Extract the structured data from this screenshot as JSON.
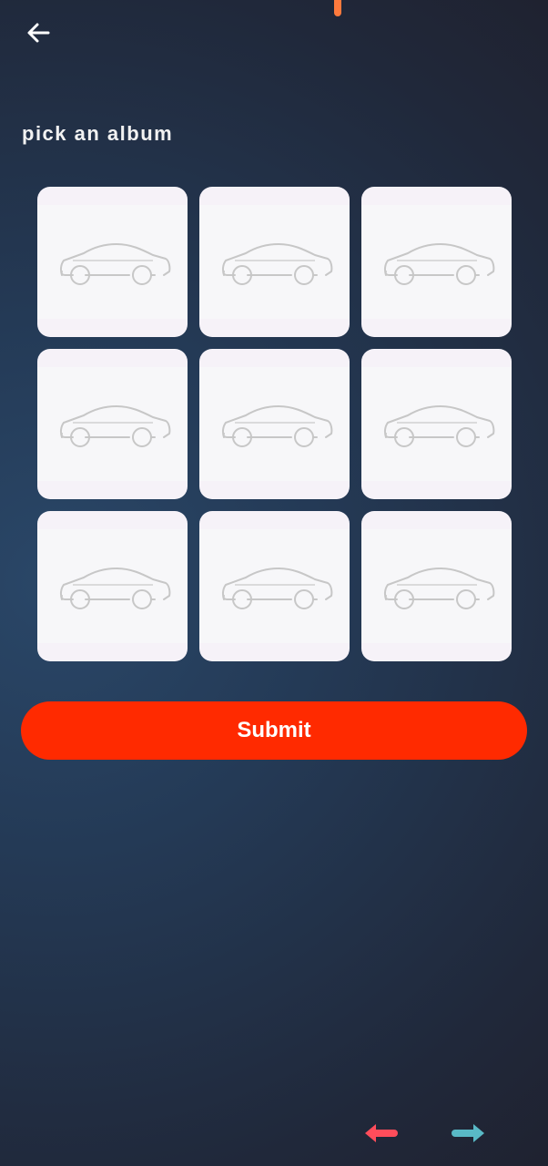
{
  "header": {
    "back_icon": "arrow-left-icon",
    "title": "pick an album"
  },
  "albums": [
    {
      "icon": "car-outline-icon"
    },
    {
      "icon": "car-outline-icon"
    },
    {
      "icon": "car-outline-icon"
    },
    {
      "icon": "car-outline-icon"
    },
    {
      "icon": "car-outline-icon"
    },
    {
      "icon": "car-outline-icon"
    },
    {
      "icon": "car-outline-icon"
    },
    {
      "icon": "car-outline-icon"
    },
    {
      "icon": "car-outline-icon"
    }
  ],
  "actions": {
    "submit_label": "Submit"
  },
  "footer_nav": {
    "prev_icon": "arrow-left-icon",
    "next_icon": "arrow-right-icon",
    "prev_color": "#ff4d5b",
    "next_color": "#59b9c6"
  },
  "colors": {
    "accent": "#ff2a00",
    "tile": "#f6f2f8"
  }
}
